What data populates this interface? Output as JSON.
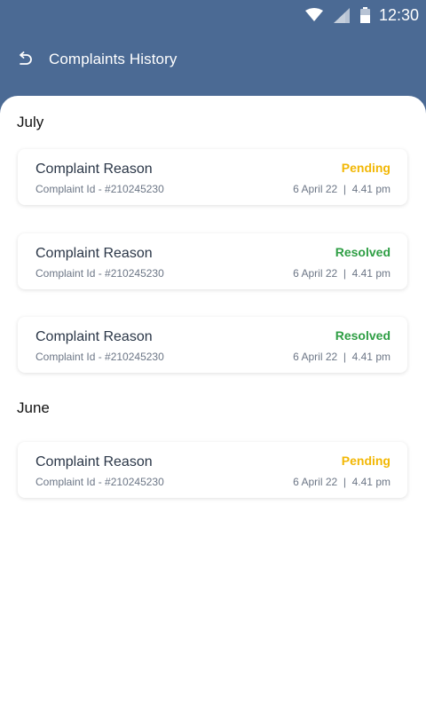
{
  "status_bar": {
    "time": "12:30",
    "icons": [
      "wifi-icon",
      "cell-signal-icon",
      "battery-icon"
    ]
  },
  "header": {
    "title": "Complaints History",
    "back_icon": "back-arrow-icon"
  },
  "colors": {
    "header_bg": "#4b6a94",
    "pending": "#f2b705",
    "resolved": "#2e9e44"
  },
  "groups": [
    {
      "month": "July",
      "items": [
        {
          "reason": "Complaint Reason",
          "id": "Complaint Id - #210245230",
          "status": "Pending",
          "datetime": "6 April 22  |  4.41 pm"
        },
        {
          "reason": "Complaint Reason",
          "id": "Complaint Id - #210245230",
          "status": "Resolved",
          "datetime": "6 April 22  |  4.41 pm"
        },
        {
          "reason": "Complaint Reason",
          "id": "Complaint Id - #210245230",
          "status": "Resolved",
          "datetime": "6 April 22  |  4.41 pm"
        }
      ]
    },
    {
      "month": "June",
      "items": [
        {
          "reason": "Complaint Reason",
          "id": "Complaint Id - #210245230",
          "status": "Pending",
          "datetime": "6 April 22  |  4.41 pm"
        }
      ]
    }
  ]
}
